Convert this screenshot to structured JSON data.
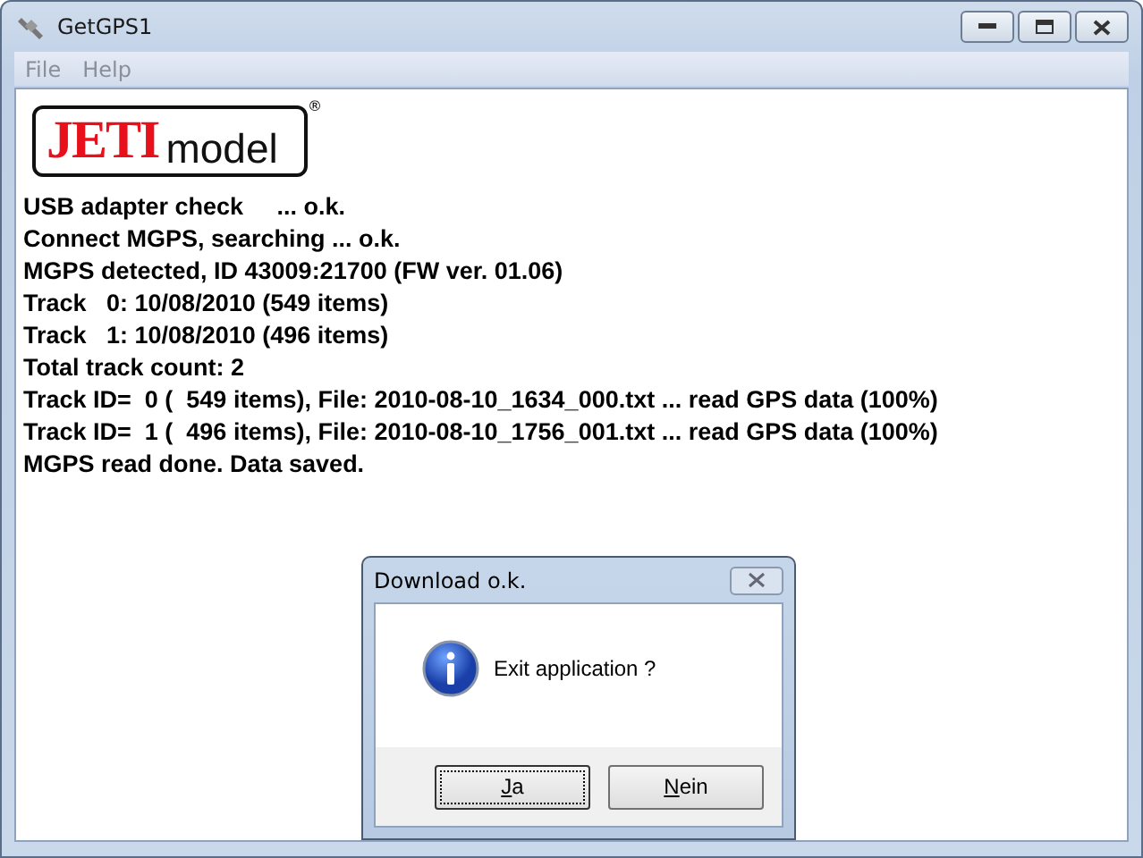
{
  "window": {
    "title": "GetGPS1"
  },
  "menu": [
    {
      "label": "File",
      "disabled": true
    },
    {
      "label": "Help",
      "disabled": true
    }
  ],
  "logo": {
    "brand": "JETI",
    "sub": "model",
    "mark": "®"
  },
  "log": [
    "USB adapter check     ... o.k.",
    "Connect MGPS, searching ... o.k.",
    "MGPS detected, ID 43009:21700 (FW ver. 01.06)",
    "Track   0: 10/08/2010 (549 items)",
    "Track   1: 10/08/2010 (496 items)",
    "Total track count: 2",
    "Track ID=  0 (  549 items), File: 2010-08-10_1634_000.txt ... read GPS data (100%)",
    "Track ID=  1 (  496 items), File: 2010-08-10_1756_001.txt ... read GPS data (100%)",
    "MGPS read done. Data saved."
  ],
  "dialog": {
    "title": "Download o.k.",
    "message": "Exit application ?",
    "buttons": [
      {
        "label": "Ja",
        "mnemonic": true,
        "focused": true
      },
      {
        "label": "Nein",
        "mnemonic": true,
        "focused": false
      }
    ]
  }
}
